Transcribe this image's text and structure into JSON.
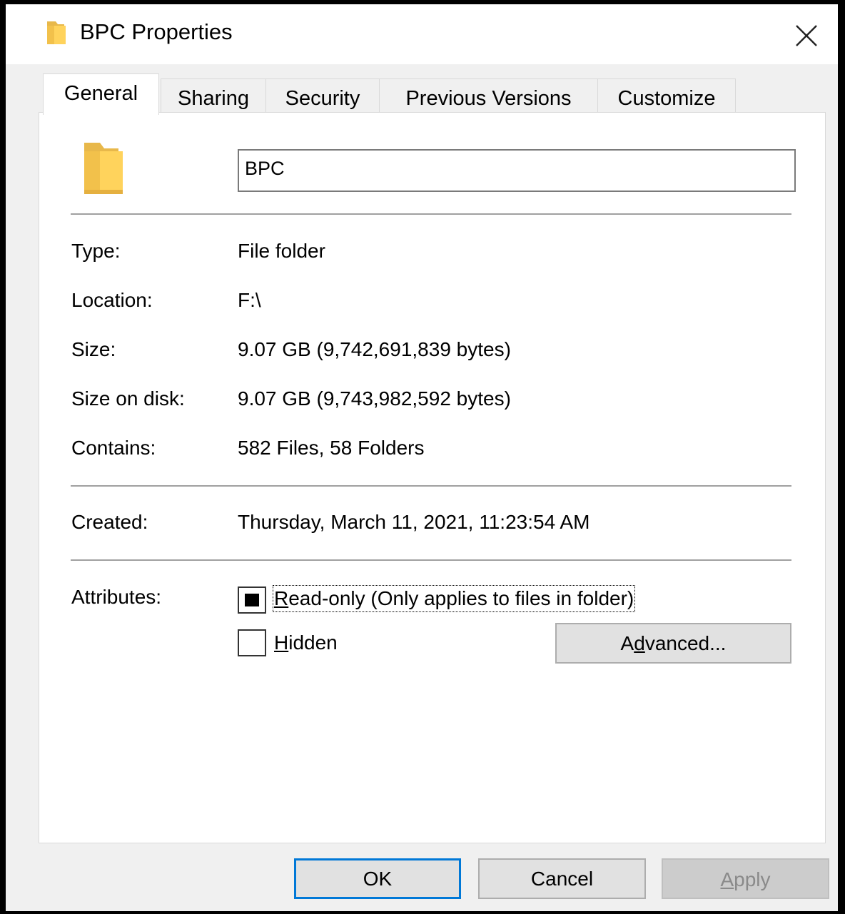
{
  "window": {
    "title": "BPC Properties",
    "close_glyph": "✕"
  },
  "tabs": [
    {
      "label": "General",
      "active": true
    },
    {
      "label": "Sharing",
      "active": false
    },
    {
      "label": "Security",
      "active": false
    },
    {
      "label": "Previous Versions",
      "active": false
    },
    {
      "label": "Customize",
      "active": false
    }
  ],
  "general": {
    "name_value": "BPC",
    "type_label": "Type:",
    "type_value": "File folder",
    "location_label": "Location:",
    "location_value": "F:\\",
    "size_label": "Size:",
    "size_value": "9.07 GB (9,742,691,839 bytes)",
    "size_on_disk_label": "Size on disk:",
    "size_on_disk_value": "9.07 GB (9,743,982,592 bytes)",
    "contains_label": "Contains:",
    "contains_value": "582 Files, 58 Folders",
    "created_label": "Created:",
    "created_value": "Thursday, March 11, 2021, 11:23:54 AM",
    "attributes_label": "Attributes:",
    "readonly": {
      "mnemonic": "R",
      "rest": "ead-only (Only applies to files in folder)",
      "state": "indeterminate"
    },
    "hidden": {
      "mnemonic": "H",
      "rest": "idden",
      "state": "unchecked"
    },
    "advanced": {
      "pre": "A",
      "mnemonic": "d",
      "post": "vanced..."
    }
  },
  "footer": {
    "ok_label": "OK",
    "cancel_label": "Cancel",
    "apply_mnemonic": "A",
    "apply_rest": "pply"
  },
  "icons": {
    "title_icon": "folder-icon",
    "large_icon": "folder-icon",
    "close": "close-icon"
  },
  "colors": {
    "accent": "#0078d7",
    "folder_light": "#ffe08a",
    "folder_dark": "#e8b84a"
  }
}
